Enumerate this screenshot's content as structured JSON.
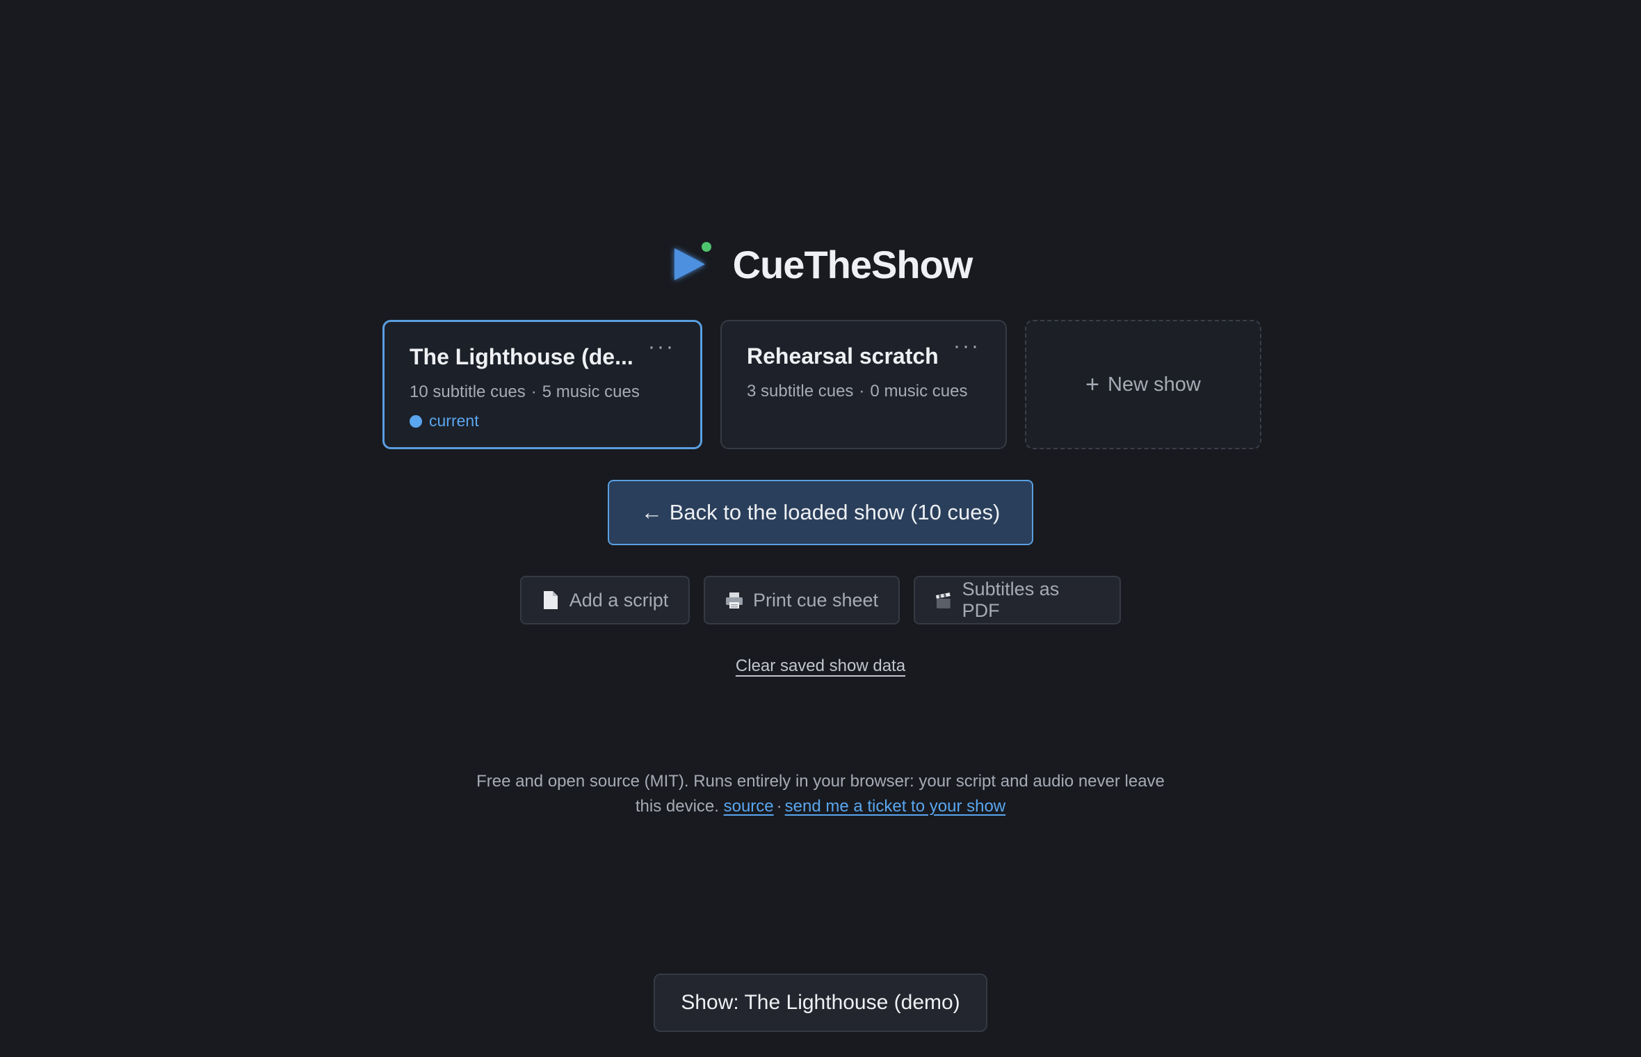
{
  "app": {
    "name": "CueTheShow"
  },
  "shows": [
    {
      "title": "The Lighthouse (de...",
      "subtitle_cues": "10 subtitle cues",
      "music_cues": "5 music cues",
      "status": "current",
      "menu_icon": "more-horizontal-icon"
    },
    {
      "title": "Rehearsal scratch",
      "subtitle_cues": "3 subtitle cues",
      "music_cues": "0 music cues",
      "menu_icon": "more-horizontal-icon"
    }
  ],
  "new_show": {
    "plus": "+",
    "label": "New show"
  },
  "back_button": {
    "arrow": "←",
    "label": "Back to the loaded show (10 cues)"
  },
  "tools": [
    {
      "label": "Add a script",
      "icon": "document-icon"
    },
    {
      "label": "Print cue sheet",
      "icon": "printer-icon"
    },
    {
      "label": "Subtitles as PDF",
      "icon": "clapperboard-icon"
    }
  ],
  "clear_link": "Clear saved show data",
  "footer": {
    "text": "Free and open source (MIT). Runs entirely in your browser: your script and audio never leave this device.",
    "source_link": "source",
    "separator": "·",
    "ticket_link": "send me a ticket to your show"
  },
  "current_show_pill": "Show: The Lighthouse (demo)",
  "colors": {
    "background": "#181a1f",
    "accent": "#5aa6ef",
    "logo_dot": "#4fc46f"
  }
}
